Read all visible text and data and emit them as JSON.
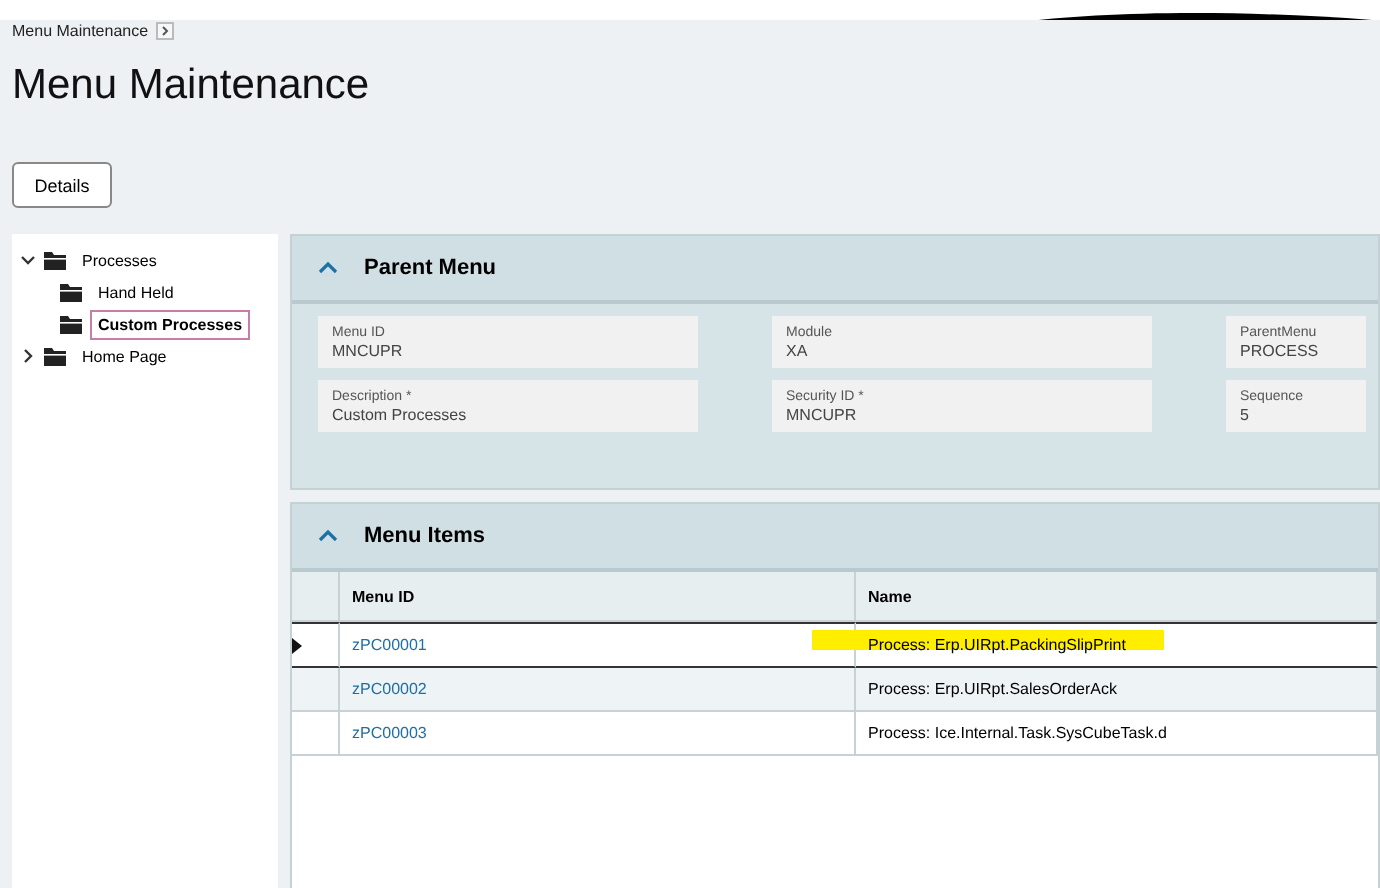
{
  "breadcrumb": {
    "label": "Menu Maintenance"
  },
  "title": "Menu Maintenance",
  "details_button": "Details",
  "tree": [
    {
      "label": "Processes",
      "expanded": true,
      "selected": false,
      "children": [
        {
          "label": "Hand Held",
          "selected": false
        },
        {
          "label": "Custom Processes",
          "selected": true
        }
      ]
    },
    {
      "label": "Home Page",
      "expanded": false,
      "selected": false
    }
  ],
  "parent_menu": {
    "title": "Parent Menu",
    "expanded": true,
    "fields": [
      {
        "label": "Menu ID",
        "value": "MNCUPR"
      },
      {
        "label": "Module",
        "value": "XA"
      },
      {
        "label": "ParentMenu",
        "value": "PROCESS"
      },
      {
        "label": "Description *",
        "value": "Custom Processes"
      },
      {
        "label": "Security ID *",
        "value": "MNCUPR"
      },
      {
        "label": "Sequence",
        "value": "5"
      }
    ]
  },
  "menu_items": {
    "title": "Menu Items",
    "expanded": true,
    "columns": [
      "Menu ID",
      "Name"
    ],
    "rows": [
      {
        "menu_id": "zPC00001",
        "name": "Process: Erp.UIRpt.PackingSlipPrint",
        "selected": true,
        "highlighted": true
      },
      {
        "menu_id": "zPC00002",
        "name": "Process: Erp.UIRpt.SalesOrderAck",
        "selected": false,
        "highlighted": false
      },
      {
        "menu_id": "zPC00003",
        "name": "Process: Ice.Internal.Task.SysCubeTask.d",
        "selected": false,
        "highlighted": false
      }
    ]
  }
}
